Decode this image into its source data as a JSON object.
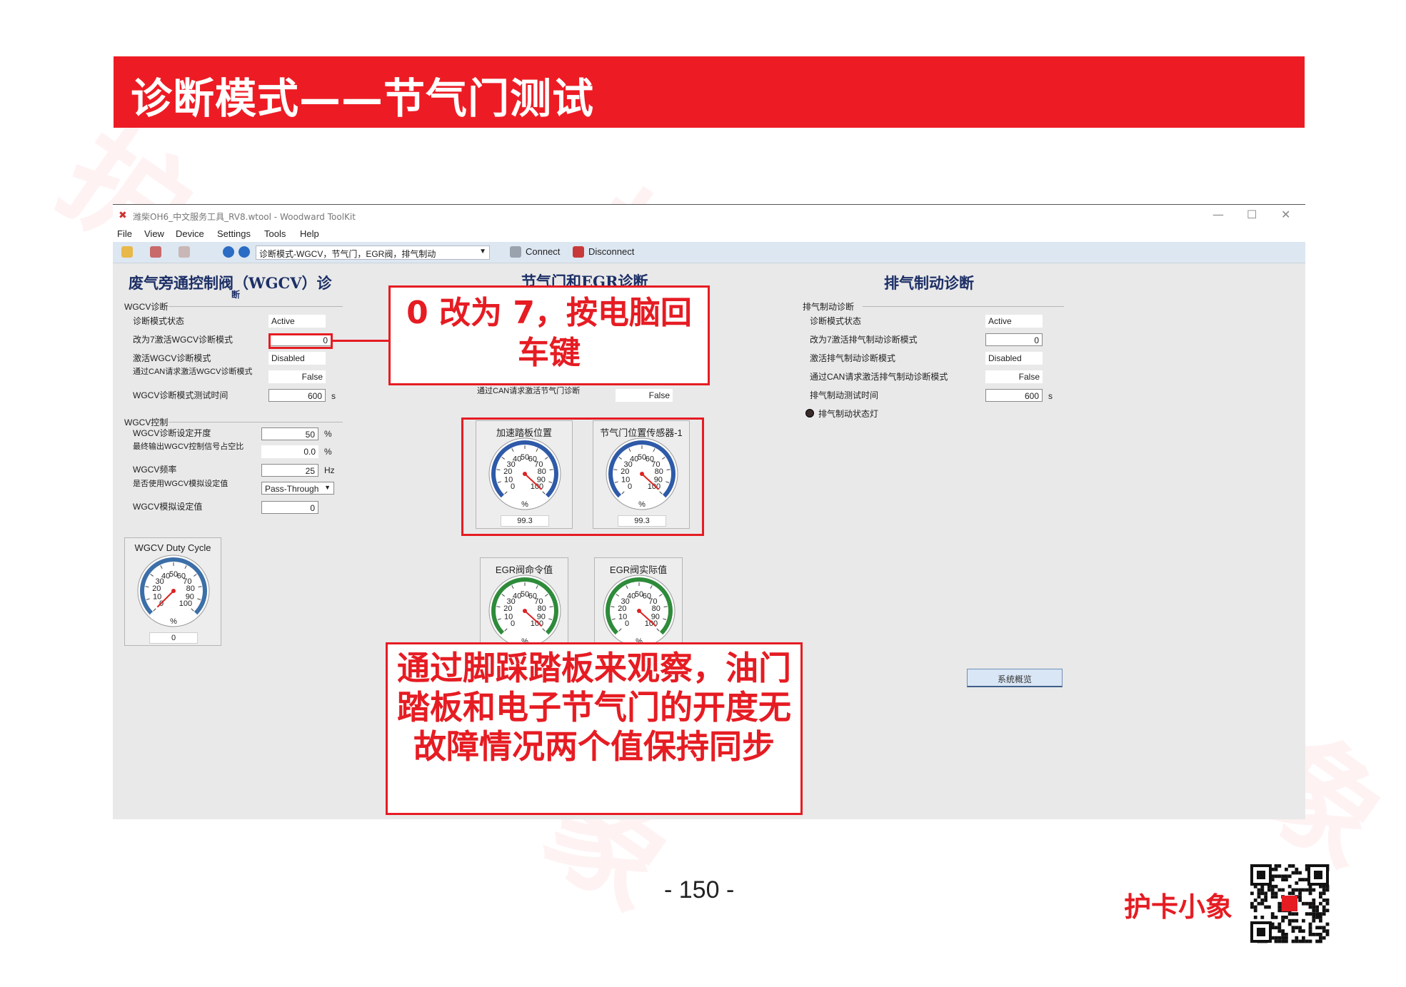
{
  "banner": {
    "title": "诊断模式——节气门测试"
  },
  "watermark": "护卡小象",
  "window": {
    "title": "潍柴OH6_中文服务工具_RV8.wtool - Woodward ToolKit",
    "menu": [
      "File",
      "View",
      "Device",
      "Settings",
      "Tools",
      "Help"
    ],
    "toolbar": {
      "mode": "诊断模式-WGCV，节气门，EGR阀，排气制动",
      "connect": "Connect",
      "disconnect": "Disconnect"
    }
  },
  "wgcv": {
    "heading": "废气旁通控制阀（WGCV）诊",
    "heading_wrap": "断",
    "diag_group": "WGCV诊断",
    "rows": [
      {
        "label": "诊断模式状态",
        "value": "Active"
      },
      {
        "label": "改为7激活WGCV诊断模式",
        "value": "0"
      },
      {
        "label": "激活WGCV诊断模式",
        "value": "Disabled"
      },
      {
        "label": "通过CAN请求激活WGCV诊断模式",
        "value": "False"
      },
      {
        "label": "WGCV诊断模式测试时间",
        "value": "600",
        "unit": "s"
      }
    ],
    "ctrl_group": "WGCV控制",
    "ctrl_rows": [
      {
        "label": "WGCV诊断设定开度",
        "value": "50",
        "unit": "%"
      },
      {
        "label": "最终输出WGCV控制信号占空比",
        "value": "0.0",
        "unit": "%"
      },
      {
        "label": "WGCV频率",
        "value": "25",
        "unit": "Hz"
      },
      {
        "label": "是否使用WGCV模拟设定值",
        "value": "Pass-Through"
      },
      {
        "label": "WGCV模拟设定值",
        "value": "0"
      }
    ],
    "gauge": {
      "title": "WGCV Duty Cycle",
      "unit": "%",
      "value": "0",
      "level_pct": 0
    }
  },
  "throttle": {
    "heading": "节气门和EGR诊断",
    "can_row": {
      "label": "通过CAN请求激活节气门诊断",
      "value": "False"
    },
    "gauges": [
      {
        "title": "加速踏板位置",
        "unit": "%",
        "value": "99.3",
        "level_pct": 99.3,
        "color": "#2e5aa8"
      },
      {
        "title": "节气门位置传感器-1",
        "unit": "%",
        "value": "99.3",
        "level_pct": 99.3,
        "color": "#2e5aa8"
      },
      {
        "title": "EGR阀命令值",
        "unit": "%",
        "level_pct": 99,
        "color": "#2e8b3a"
      },
      {
        "title": "EGR阀实际值",
        "unit": "%",
        "level_pct": 99,
        "color": "#2e8b3a"
      }
    ]
  },
  "exhaust": {
    "heading": "排气制动诊断",
    "group": "排气制动诊断",
    "rows": [
      {
        "label": "诊断模式状态",
        "value": "Active"
      },
      {
        "label": "改为7激活排气制动诊断模式",
        "value": "0"
      },
      {
        "label": "激活排气制动诊断模式",
        "value": "Disabled"
      },
      {
        "label": "通过CAN请求激活排气制动诊断模式",
        "value": "False"
      },
      {
        "label": "排气制动测试时间",
        "value": "600",
        "unit": "s"
      }
    ],
    "lamp_label": "排气制动状态灯",
    "overview_button": "系统概览"
  },
  "gauge_ticks": [
    "0",
    "10",
    "20",
    "30",
    "40",
    "50",
    "60",
    "70",
    "80",
    "90",
    "100"
  ],
  "callouts": {
    "top": "0 改为 7，按电脑回车键",
    "bottom": "通过脚踩踏板来观察，油门踏板和电子节气门的开度无故障情况两个值保持同步"
  },
  "footer": {
    "page_number": "- 150 -",
    "brand": "护卡小象"
  },
  "colors": {
    "accent_red": "#ed1c24",
    "heading_blue": "#1c2f66"
  }
}
